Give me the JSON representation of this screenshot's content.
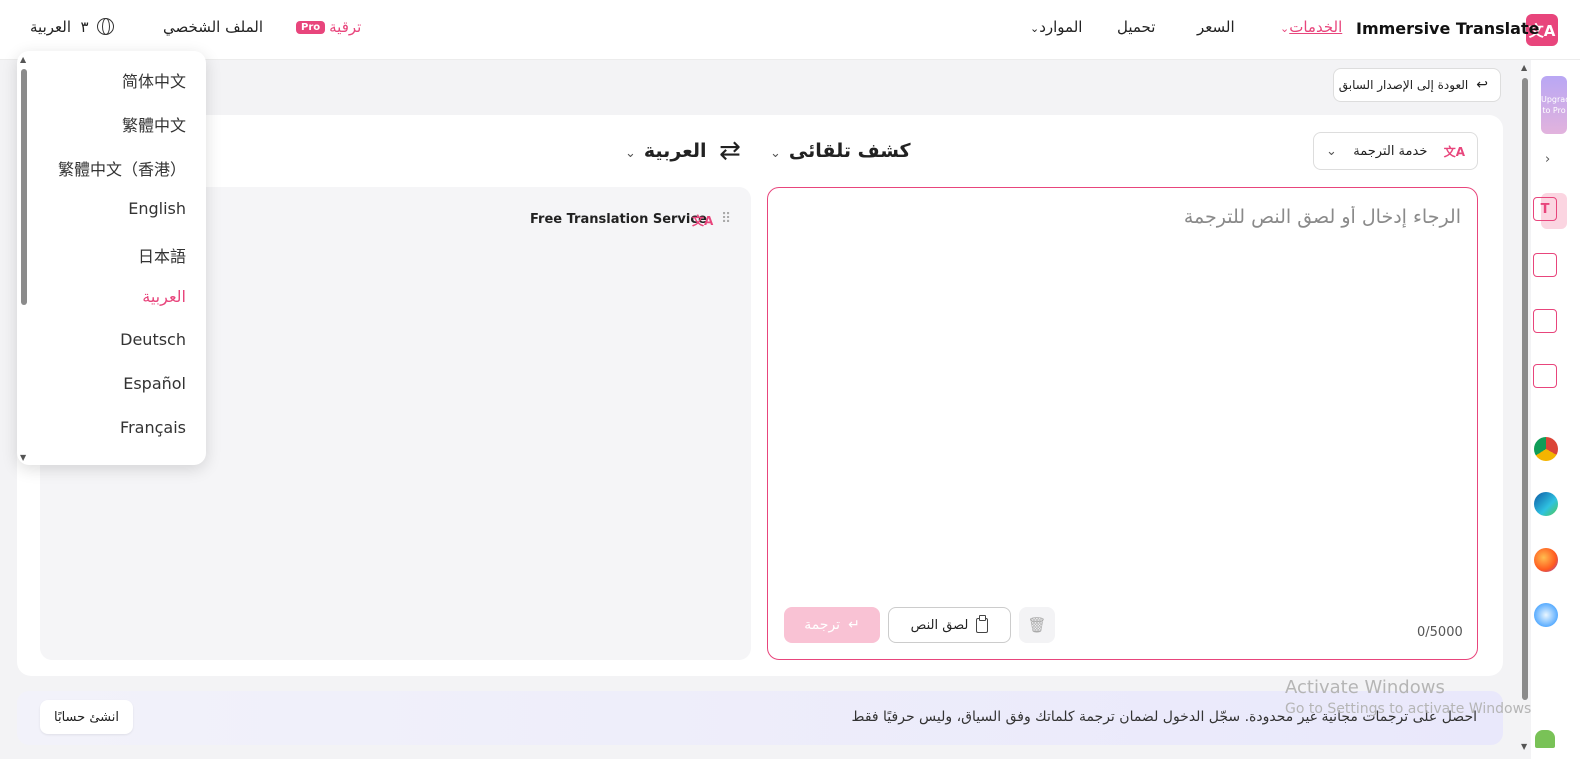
{
  "nav": {
    "brand": "Immersive Translate",
    "brand_logo": "文A",
    "services": "الخدمات",
    "price": "السعر",
    "download": "تحميل",
    "resources": "الموارد",
    "upgrade": "ترقية",
    "pro_badge": "Pro",
    "profile": "الملف الشخصي",
    "language": "العربية",
    "language_suffix": "٣"
  },
  "back_button": "العودة إلى الإصدار السابق",
  "service_button": "خدمة الترجمة",
  "source_lang": "كشف تلقائى",
  "target_lang": "العربية",
  "result": {
    "service_name": "Free Translation Service"
  },
  "input": {
    "placeholder": "الرجاء إدخال أو لصق النص للترجمة",
    "value": "",
    "char_count": "0/5000"
  },
  "buttons": {
    "translate": "ترجمة",
    "paste": "لصق النص"
  },
  "banner": {
    "text": "احصل على ترجمات مجانية غير محدودة. سجّل الدخول لضمان ترجمة كلماتك وفق السياق، وليس حرفيًا فقط",
    "signup": "انشئ حسابًا"
  },
  "watermark": {
    "title": "Activate Windows",
    "subtitle": "Go to Settings to activate Windows."
  },
  "sidebar": {
    "upgrade": "Upgrade to Pro"
  },
  "dropdown": {
    "items": [
      "简体中文",
      "繁體中文",
      "繁體中文（香港）",
      "English",
      "日本語",
      "العربية",
      "Deutsch",
      "Español",
      "Français"
    ],
    "selected": "العربية"
  },
  "colors": {
    "accent": "#e8457c",
    "translate_disabled": "#f9c2d4"
  }
}
